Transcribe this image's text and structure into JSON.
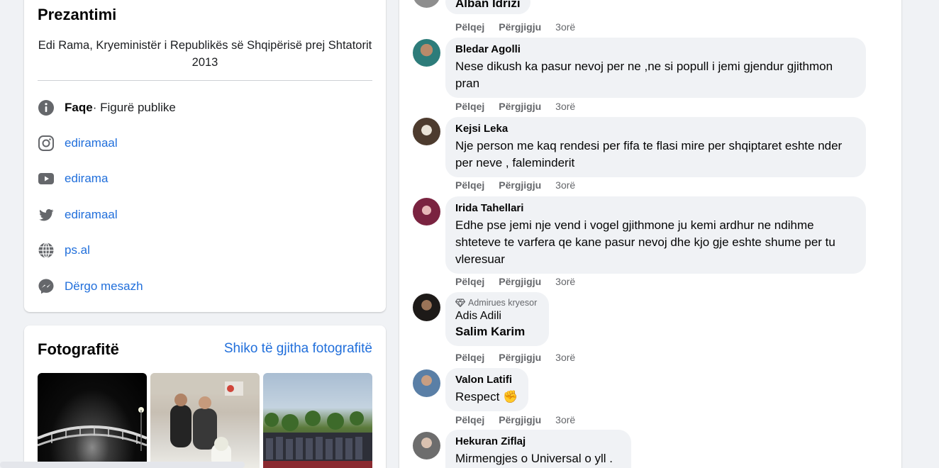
{
  "intro": {
    "title": "Prezantimi",
    "bio": "Edi Rama, Kryeministër i Republikës së Shqipërisë prej Shtatorit 2013",
    "page_label": "Faqe",
    "page_category": " · Figurë publike",
    "instagram": "ediramaal",
    "youtube": "edirama",
    "twitter": "ediramaal",
    "website": "ps.al",
    "message": "Dërgo mesazh"
  },
  "photos": {
    "title": "Fotografitë",
    "see_all": "Shiko të gjitha fotografitë"
  },
  "comments": [
    {
      "author": "",
      "text": "Alban Idrizi",
      "time": "3orë"
    },
    {
      "author": "Bledar Agolli",
      "text": "Nese dikush ka pasur nevoj per ne ,ne si popull i jemi gjendur gjithmon pran",
      "time": "3orë"
    },
    {
      "author": "Kejsi Leka",
      "text": "Nje person me kaq rendesi per fifa te flasi mire per shqiptaret eshte nder per neve , faleminderit",
      "time": "3orë"
    },
    {
      "author": "Irida Tahellari",
      "text": "Edhe pse jemi nje vend i vogel gjithmone ju kemi ardhur ne ndihme shteteve te varfera qe kane pasur nevoj dhe kjo gje eshte shume per tu vleresuar",
      "time": "3orë"
    },
    {
      "badge": "Admirues kryesor",
      "author": "Adis Adili",
      "text": "Salim Karim",
      "time": "3orë"
    },
    {
      "author": "Valon Latifi",
      "text": "Respect ✊",
      "time": "3orë"
    },
    {
      "author": "Hekuran Ziflaj",
      "text": "Mirmengjes o Universal o yll .",
      "time": ""
    }
  ],
  "actions": {
    "like": "Pëlqej",
    "reply": "Përgjigju"
  },
  "colors": {
    "link": "#216fdb",
    "bubble": "#f0f2f5",
    "muted": "#65676b"
  }
}
